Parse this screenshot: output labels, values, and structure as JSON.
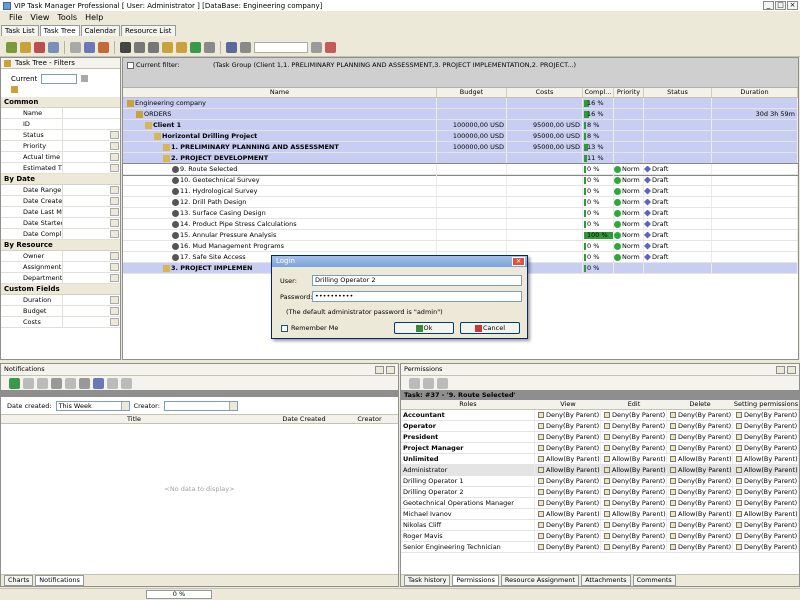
{
  "window": {
    "title": "VIP Task Manager Professional [ User: Administrator ] [DataBase: Engineering company]"
  },
  "menu": [
    "File",
    "View",
    "Tools",
    "Help"
  ],
  "main_tabs": [
    "Task List",
    "Task Tree",
    "Calendar",
    "Resource List"
  ],
  "active_tab": "Task Tree",
  "filters_panel": {
    "title": "Task Tree - Filters",
    "current_label": "Current",
    "groups": [
      {
        "name": "Common",
        "items": [
          "Name",
          "ID",
          "Status",
          "Priority",
          "Actual time",
          "Estimated Ti"
        ]
      },
      {
        "name": "By Date",
        "items": [
          "Date Range",
          "Date Create",
          "Date Last M",
          "Date Startec",
          "Date Compl"
        ]
      },
      {
        "name": "By Resource",
        "items": [
          "Owner",
          "Assignment",
          "Department"
        ]
      },
      {
        "name": "Custom Fields",
        "items": [
          "Duration",
          "Budget",
          "Costs"
        ]
      }
    ]
  },
  "current_filter": {
    "label": "Current filter:",
    "value": "(Task Group  (Client 1,1. PRELIMINARY PLANNING AND ASSESSMENT,3. PROJECT IMPLEMENTATION,2. PROJECT...)"
  },
  "grid": {
    "columns": [
      "Name",
      "Budget",
      "Costs",
      "Compl...",
      "Priority",
      "Status",
      "Duration"
    ],
    "rows": [
      {
        "name": "Engineering company",
        "budget": "",
        "costs": "",
        "complete": "16 %",
        "priority": "",
        "status": "",
        "duration": "",
        "level": 0,
        "style": "blue"
      },
      {
        "name": "ORDERS",
        "budget": "",
        "costs": "",
        "complete": "16 %",
        "priority": "",
        "status": "",
        "duration": "30d 3h 59m",
        "level": 1,
        "style": "blue"
      },
      {
        "name": "Client 1",
        "budget": "100000,00 USD",
        "costs": "95000,00 USD",
        "complete": "8 %",
        "priority": "",
        "status": "",
        "duration": "",
        "level": 2,
        "style": "blue-bold"
      },
      {
        "name": "Horizontal Drilling Project",
        "budget": "100000,00 USD",
        "costs": "95000,00 USD",
        "complete": "8 %",
        "priority": "",
        "status": "",
        "duration": "",
        "level": 3,
        "style": "blue-bold"
      },
      {
        "name": "1. PRELIMINARY PLANNING AND ASSESSMENT",
        "budget": "100000,00 USD",
        "costs": "95000,00 USD",
        "complete": "13 %",
        "priority": "",
        "status": "",
        "duration": "",
        "level": 4,
        "style": "blue-bold"
      },
      {
        "name": "2. PROJECT DEVELOPMENT",
        "budget": "",
        "costs": "",
        "complete": "11 %",
        "priority": "",
        "status": "",
        "duration": "",
        "level": 4,
        "style": "blue-bold"
      },
      {
        "name": "9. Route Selected",
        "budget": "",
        "costs": "",
        "complete": "0 %",
        "priority": "Norm",
        "status": "Draft",
        "duration": "",
        "level": 5,
        "style": "selected"
      },
      {
        "name": "10. Geotechnical Survey",
        "budget": "",
        "costs": "",
        "complete": "0 %",
        "priority": "Norm",
        "status": "Draft",
        "duration": "",
        "level": 5,
        "style": ""
      },
      {
        "name": "11. Hydrological Survey",
        "budget": "",
        "costs": "",
        "complete": "0 %",
        "priority": "Norm",
        "status": "Draft",
        "duration": "",
        "level": 5,
        "style": ""
      },
      {
        "name": "12. Drill Path Design",
        "budget": "",
        "costs": "",
        "complete": "0 %",
        "priority": "Norm",
        "status": "Draft",
        "duration": "",
        "level": 5,
        "style": ""
      },
      {
        "name": "13. Surface Casing Design",
        "budget": "",
        "costs": "",
        "complete": "0 %",
        "priority": "Norm",
        "status": "Draft",
        "duration": "",
        "level": 5,
        "style": ""
      },
      {
        "name": "14. Product Pipe Stress Calculations",
        "budget": "",
        "costs": "",
        "complete": "0 %",
        "priority": "Norm",
        "status": "Draft",
        "duration": "",
        "level": 5,
        "style": ""
      },
      {
        "name": "15. Annular Pressure Analysis",
        "budget": "",
        "costs": "",
        "complete": "100 %",
        "priority": "Norm",
        "status": "Draft",
        "duration": "",
        "level": 5,
        "style": ""
      },
      {
        "name": "16. Mud Management Programs",
        "budget": "",
        "costs": "",
        "complete": "0 %",
        "priority": "Norm",
        "status": "Draft",
        "duration": "",
        "level": 5,
        "style": ""
      },
      {
        "name": "17. Safe Site Access",
        "budget": "",
        "costs": "",
        "complete": "0 %",
        "priority": "Norm",
        "status": "Draft",
        "duration": "",
        "level": 5,
        "style": ""
      },
      {
        "name": "3. PROJECT IMPLEMEN",
        "budget": "",
        "costs": "",
        "complete": "0 %",
        "priority": "",
        "status": "",
        "duration": "",
        "level": 4,
        "style": "blue-bold"
      }
    ]
  },
  "login": {
    "title": "Login",
    "user_label": "User:",
    "user_value": "Drilling Operator 2",
    "password_label": "Password:",
    "password_value": "••••••••••",
    "hint": "(The default administrator password is \"admin\")",
    "remember_label": "Remember Me",
    "ok_label": "Ok",
    "cancel_label": "Cancel"
  },
  "notifications": {
    "title": "Notifications",
    "date_created_label": "Date created:",
    "date_created_value": "This Week",
    "creator_label": "Creator:",
    "columns": [
      "Title",
      "Date Created",
      "Creator"
    ],
    "empty_text": "<No data to display>",
    "tabs": [
      "Charts",
      "Notifications"
    ]
  },
  "permissions": {
    "title": "Permissions",
    "task_title": "Task: #37 - '9. Route Selected'",
    "columns": [
      "Roles",
      "View",
      "Edit",
      "Delete",
      "Setting permissions"
    ],
    "rows": [
      {
        "role": "Accountant",
        "bold": true,
        "view": "Deny(By Parent)",
        "edit": "Deny(By Parent)",
        "delete": "Deny(By Parent)",
        "setting": "Deny(By Parent)"
      },
      {
        "role": "Operator",
        "bold": true,
        "view": "Deny(By Parent)",
        "edit": "Deny(By Parent)",
        "delete": "Deny(By Parent)",
        "setting": "Deny(By Parent)"
      },
      {
        "role": "President",
        "bold": true,
        "view": "Deny(By Parent)",
        "edit": "Deny(By Parent)",
        "delete": "Deny(By Parent)",
        "setting": "Deny(By Parent)"
      },
      {
        "role": "Project Manager",
        "bold": true,
        "view": "Deny(By Parent)",
        "edit": "Deny(By Parent)",
        "delete": "Deny(By Parent)",
        "setting": "Deny(By Parent)"
      },
      {
        "role": "Unlimited",
        "bold": true,
        "view": "Allow(By Parent)",
        "edit": "Allow(By Parent)",
        "delete": "Allow(By Parent)",
        "setting": "Allow(By Parent)"
      },
      {
        "role": "Administrator",
        "bold": false,
        "view": "Allow(By Parent)",
        "edit": "Allow(By Parent)",
        "delete": "Allow(By Parent)",
        "setting": "Allow(By Parent)"
      },
      {
        "role": "Drilling Operator 1",
        "bold": false,
        "view": "Deny(By Parent)",
        "edit": "Deny(By Parent)",
        "delete": "Deny(By Parent)",
        "setting": "Deny(By Parent)"
      },
      {
        "role": "Drilling Operator 2",
        "bold": false,
        "view": "Deny(By Parent)",
        "edit": "Deny(By Parent)",
        "delete": "Deny(By Parent)",
        "setting": "Deny(By Parent)"
      },
      {
        "role": "Geotechnical Operations Manager",
        "bold": false,
        "view": "Deny(By Parent)",
        "edit": "Deny(By Parent)",
        "delete": "Deny(By Parent)",
        "setting": "Deny(By Parent)"
      },
      {
        "role": "Michael Ivanov",
        "bold": false,
        "view": "Allow(By Parent)",
        "edit": "Allow(By Parent)",
        "delete": "Allow(By Parent)",
        "setting": "Allow(By Parent)"
      },
      {
        "role": "Nikolas Cliff",
        "bold": false,
        "view": "Deny(By Parent)",
        "edit": "Deny(By Parent)",
        "delete": "Deny(By Parent)",
        "setting": "Deny(By Parent)"
      },
      {
        "role": "Roger Mavis",
        "bold": false,
        "view": "Deny(By Parent)",
        "edit": "Deny(By Parent)",
        "delete": "Deny(By Parent)",
        "setting": "Deny(By Parent)"
      },
      {
        "role": "Senior Engineering Technician",
        "bold": false,
        "view": "Deny(By Parent)",
        "edit": "Deny(By Parent)",
        "delete": "Deny(By Parent)",
        "setting": "Deny(By Parent)"
      }
    ],
    "tabs": [
      "Task history",
      "Permissions",
      "Resource Assignment",
      "Attachments",
      "Comments"
    ],
    "active_tab": "Permissions"
  },
  "status_bar": {
    "progress_text": "0 %"
  },
  "colors": {
    "group_row": "#c8cdf2",
    "progress": "#2e9a35",
    "priority_normal": "#2ea83a",
    "status_draft": "#5c63c4"
  }
}
